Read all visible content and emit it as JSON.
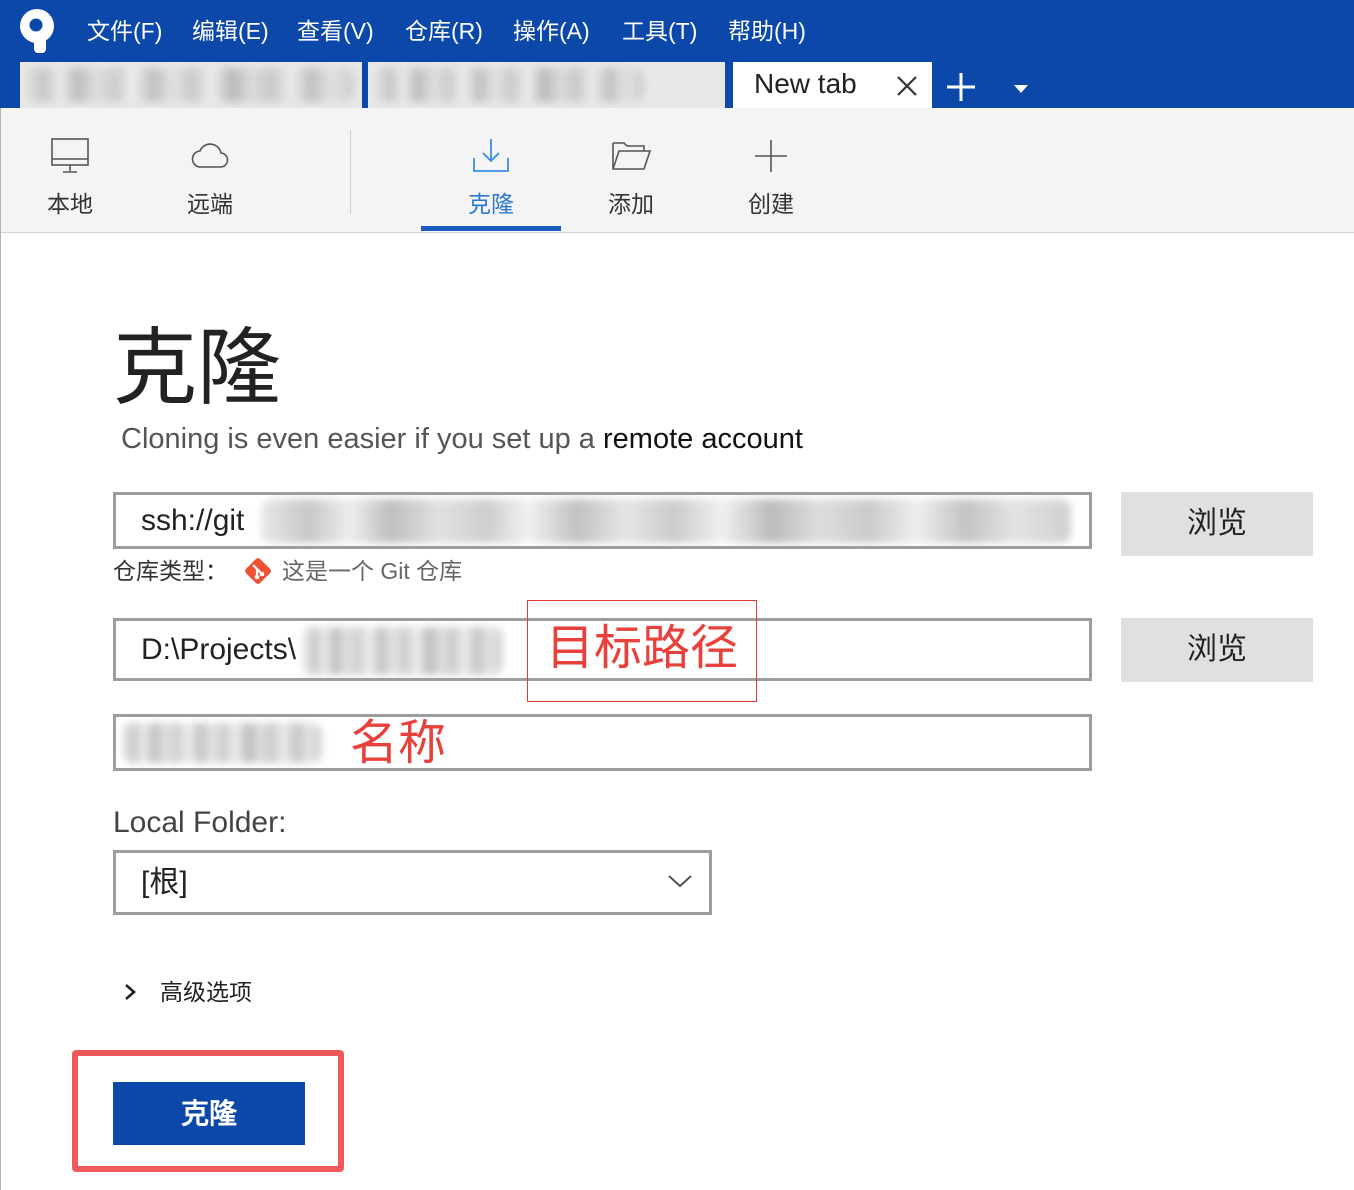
{
  "menu": {
    "items": [
      "文件(F)",
      "编辑(E)",
      "查看(V)",
      "仓库(R)",
      "操作(A)",
      "工具(T)",
      "帮助(H)"
    ]
  },
  "tabs": {
    "active_label": "New tab"
  },
  "toolbar": {
    "items": [
      {
        "label": "本地",
        "icon": "monitor-icon"
      },
      {
        "label": "远端",
        "icon": "cloud-icon"
      },
      {
        "label": "克隆",
        "icon": "download-icon",
        "selected": true
      },
      {
        "label": "添加",
        "icon": "folder-open-icon"
      },
      {
        "label": "创建",
        "icon": "plus-icon"
      }
    ]
  },
  "clone": {
    "title": "克隆",
    "subtitle_prefix": "Cloning is even easier if you set up a ",
    "subtitle_link": "remote account",
    "source_url": "ssh://git",
    "browse_label": "浏览",
    "repo_type_label": "仓库类型：",
    "repo_type_value": "这是一个 Git 仓库",
    "destination_path": "D:\\Projects\\",
    "local_folder_label": "Local Folder:",
    "local_folder_value": "[根]",
    "advanced_label": "高级选项",
    "clone_button": "克隆"
  },
  "annotations": {
    "destination_path": "目标路径",
    "name": "名称"
  },
  "colors": {
    "accent": "#0b48a9",
    "selected_tab_text": "#2a78d2",
    "annotation_red": "#e8403a",
    "git_orange": "#f05133"
  }
}
